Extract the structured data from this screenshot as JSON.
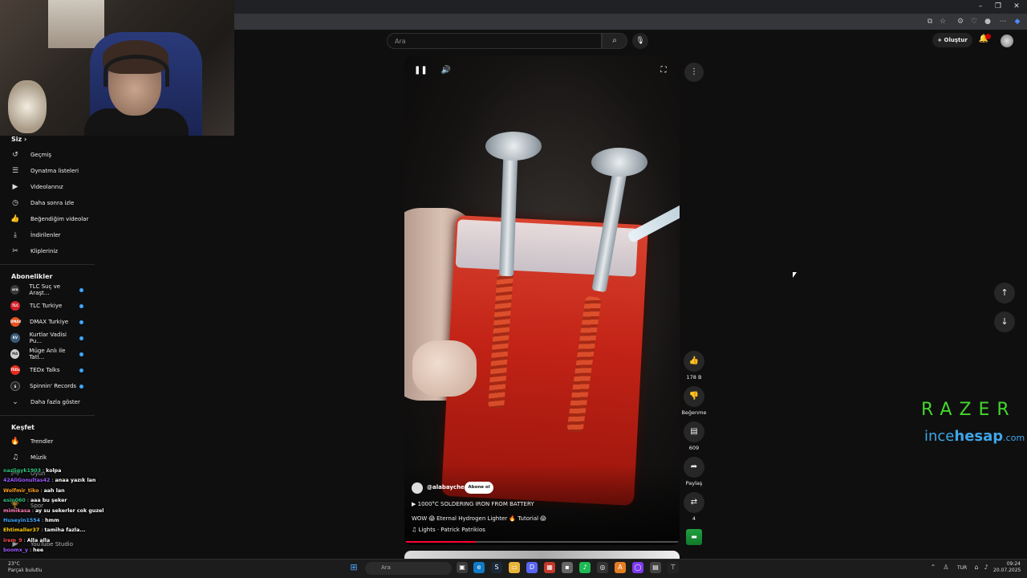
{
  "browser": {
    "window_controls": [
      "–",
      "❐",
      "✕"
    ]
  },
  "header": {
    "search_placeholder": "Ara",
    "create_label": "Oluştur"
  },
  "sidebar": {
    "you_section": {
      "title": "Siz",
      "items": [
        {
          "label": "Geçmiş",
          "icon": "history-icon"
        },
        {
          "label": "Oynatma listeleri",
          "icon": "playlist-icon"
        },
        {
          "label": "Videolarınız",
          "icon": "your-videos-icon"
        },
        {
          "label": "Daha sonra izle",
          "icon": "watch-later-icon"
        },
        {
          "label": "Beğendiğim videolar",
          "icon": "liked-videos-icon"
        },
        {
          "label": "İndirilenler",
          "icon": "downloads-icon"
        },
        {
          "label": "Klipleriniz",
          "icon": "clips-icon"
        }
      ]
    },
    "subscriptions": {
      "title": "Abonelikler",
      "items": [
        {
          "label": "TLC Suç ve Araşt...",
          "color": "#3a3a3a",
          "badge": "ara",
          "live": true
        },
        {
          "label": "TLC Turkiye",
          "color": "#d4202a",
          "badge": "TLC",
          "live": true
        },
        {
          "label": "DMAX Turkiye",
          "color": "#e8531f",
          "badge": "DMAX",
          "live": true
        },
        {
          "label": "Kurtlar Vadisi Pu...",
          "color": "#3b5a7a",
          "badge": "KV",
          "live": true
        },
        {
          "label": "Müge Anlı ile Tatl...",
          "color": "#cfcfcf",
          "badge": "MA",
          "live": true
        },
        {
          "label": "TEDx Talks",
          "color": "#e62b1e",
          "badge": "TEDx",
          "live": true
        },
        {
          "label": "Spinnin' Records",
          "color": "#222222",
          "badge": "S",
          "live": true
        }
      ],
      "show_more": "Daha fazla göster"
    },
    "explore": {
      "title": "Keşfet",
      "items": [
        {
          "label": "Trendler",
          "icon": "trending-icon"
        },
        {
          "label": "Müzik",
          "icon": "music-icon"
        }
      ]
    },
    "partial_items": [
      "Oyun",
      "Spor",
      "YouTube Studio"
    ]
  },
  "chat": [
    {
      "user": "nazligyk1903",
      "msg": "kolpa",
      "color": "#2ec27e"
    },
    {
      "user": "42AliGonultas42",
      "msg": "anaa yazık lan",
      "color": "#9b59ff"
    },
    {
      "user": "Wolfmir_tiko",
      "msg": "aah lan",
      "color": "#ff9f1c"
    },
    {
      "user": "esin060",
      "msg": "aaa bu şeker",
      "color": "#2ec27e"
    },
    {
      "user": "mimikasa",
      "msg": "ay su sekerler cok guzel",
      "color": "#ff7eb6"
    },
    {
      "user": "Huseyin1554",
      "msg": "hmm",
      "color": "#3ea6ff"
    },
    {
      "user": "Ehtimaller37",
      "msg": "tamiha fazla...",
      "color": "#ffcc00"
    },
    {
      "user": "irem_9",
      "msg": "Alla alla",
      "color": "#ff4d4d"
    },
    {
      "user": "boomx_y",
      "msg": "hee",
      "color": "#9b59ff"
    }
  ],
  "video": {
    "channel": "@alabaychec",
    "subscribe_label": "Abone ol",
    "link_line": "1000°C SOLDERING IRON FROM BATTERY",
    "description": "WOW 😱 Eternal Hydrogen Lighter 🔥 Tutorial 😱",
    "music_line": "Lights · Patrick Patrikios",
    "progress": 0.26,
    "controls": {
      "pause": "❚❚",
      "volume": "🔊",
      "fullscreen": "⛶",
      "more": "⋮"
    }
  },
  "actions": {
    "like_count": "178 B",
    "dislike_label": "Beğenme",
    "comments_count": "609",
    "share_label": "Paylaş",
    "remix_count": "4"
  },
  "overlay": {
    "razer_text": "RAZER",
    "ince_a": "ince",
    "ince_b": "hesap",
    "ince_c": ".com"
  },
  "taskbar": {
    "weather_temp": "23°C",
    "weather_desc": "Parçalı bulutlu",
    "search_label": "Ara",
    "language": "TUR",
    "time": "09:24",
    "date": "20.07.2025"
  },
  "colors": {
    "accent": "#ff0033",
    "razer_green": "#44d62c",
    "ince_blue": "#3fa6e8"
  }
}
